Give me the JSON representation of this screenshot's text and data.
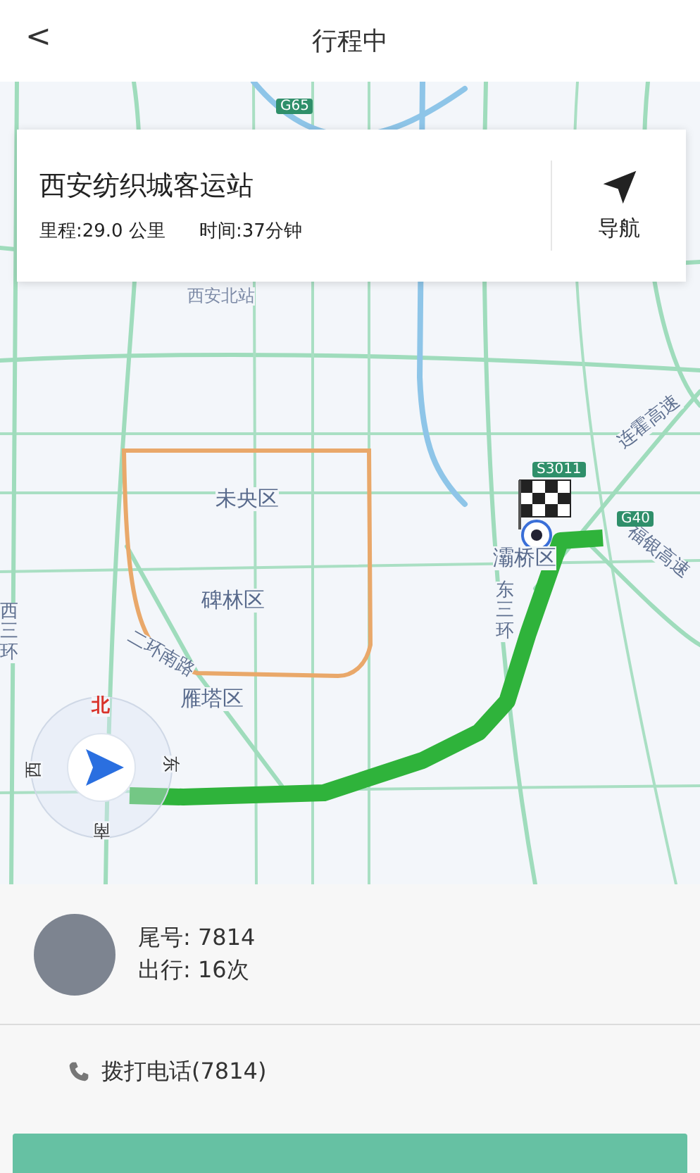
{
  "header": {
    "back": "<",
    "title": "行程中"
  },
  "trip_card": {
    "destination": "西安纺织城客运站",
    "distance": "里程:29.0 公里",
    "duration": "时间:37分钟",
    "nav_label": "导航"
  },
  "map": {
    "labels": [
      {
        "text": "G65",
        "kind": "shield"
      },
      {
        "text": "西安北站",
        "kind": "station"
      },
      {
        "text": "未央区",
        "kind": "district"
      },
      {
        "text": "碑林区",
        "kind": "district"
      },
      {
        "text": "雁塔区",
        "kind": "district"
      },
      {
        "text": "灞桥区",
        "kind": "district"
      },
      {
        "text": "二环南路",
        "kind": "road"
      },
      {
        "text": "东三环",
        "kind": "vroad"
      },
      {
        "text": "西三环",
        "kind": "vroad"
      },
      {
        "text": "福银高速",
        "kind": "road"
      },
      {
        "text": "连霍高速",
        "kind": "road"
      },
      {
        "text": "S3011",
        "kind": "shield"
      },
      {
        "text": "G40",
        "kind": "shield"
      },
      {
        "text": "北",
        "kind": "compass-north"
      },
      {
        "text": "东",
        "kind": "compass"
      },
      {
        "text": "南",
        "kind": "compass"
      },
      {
        "text": "西",
        "kind": "compass"
      }
    ]
  },
  "driver": {
    "tail_number": "尾号: 7814",
    "trips": "出行: 16次"
  },
  "call": {
    "label": "拨打电话(7814)"
  }
}
